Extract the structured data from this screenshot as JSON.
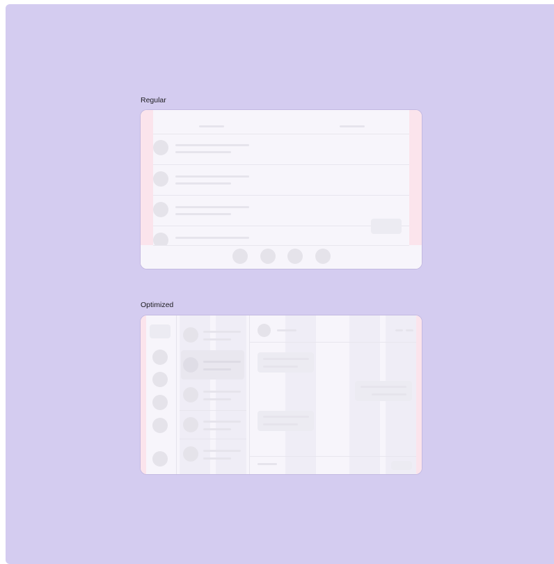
{
  "labels": {
    "regular": "Regular",
    "optimized": "Optimized"
  },
  "colors": {
    "background": "#d4ccf0",
    "frame": "#f7f5fb",
    "margin_gutter": "#fbe4ec",
    "skeleton": "#e6e4ec"
  }
}
